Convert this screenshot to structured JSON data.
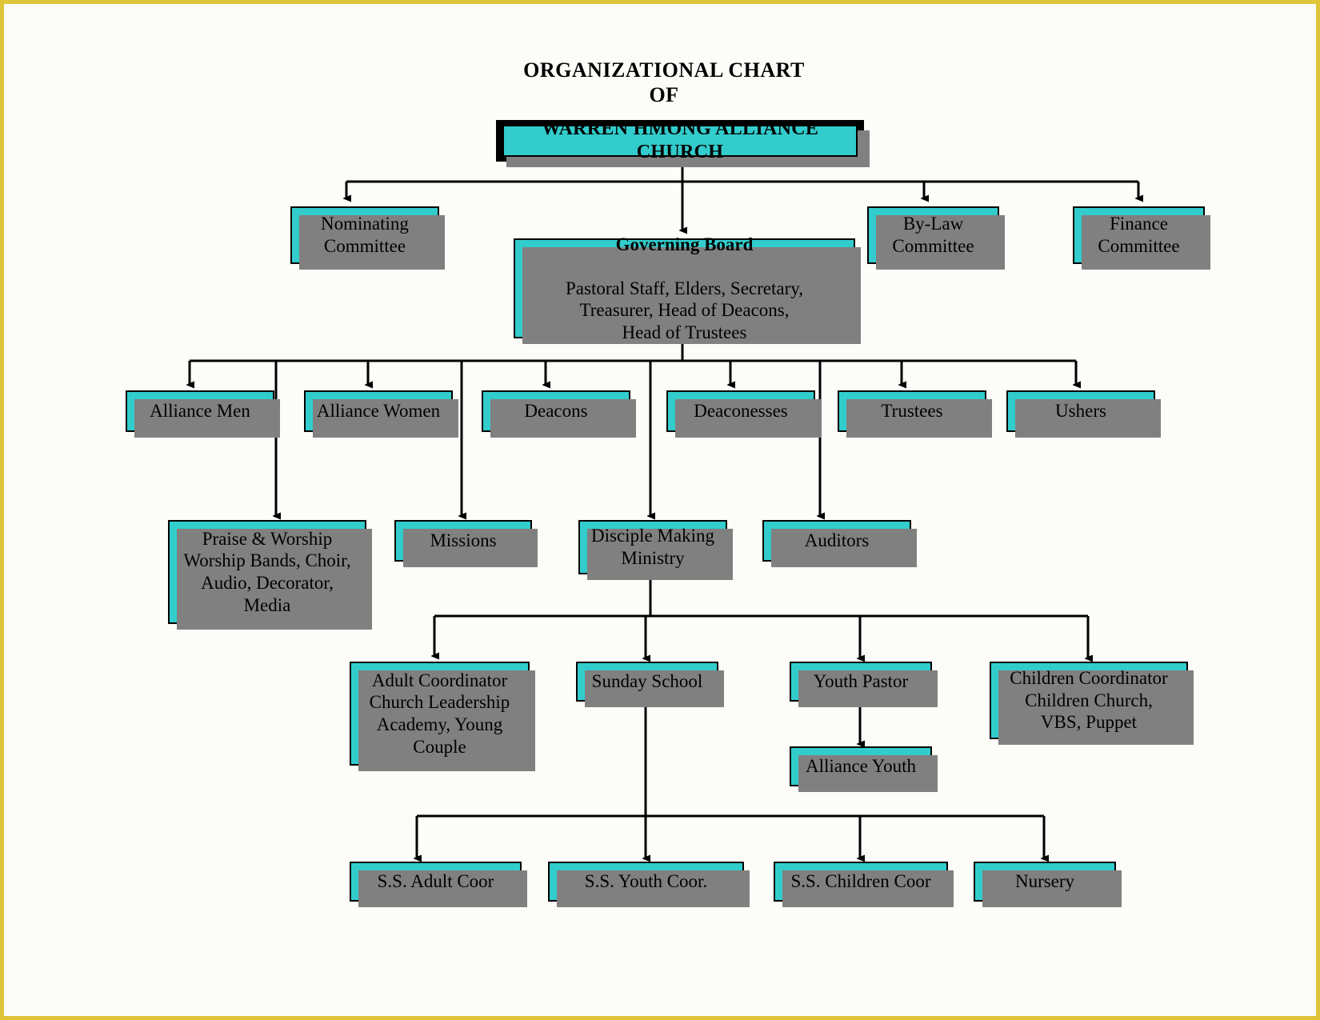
{
  "page": {
    "background_color": "#fcfdf8",
    "border_color": "#dfc43a",
    "node_fill_color": "#33cccc",
    "node_border_color": "#000000",
    "node_shadow_color": "#808080",
    "connector_color": "#000000"
  },
  "title": {
    "line1": "ORGANIZATIONAL CHART",
    "line2": "OF"
  },
  "chart_data": {
    "type": "diagram",
    "subtype": "organizational-chart",
    "title": "ORGANIZATIONAL CHART OF WARREN HMONG ALLIANCE CHURCH",
    "nodes": {
      "root": {
        "label": "WARREN HMONG ALLIANCE CHURCH"
      },
      "nominating_committee": {
        "label": "Nominating\nCommittee"
      },
      "governing_board": {
        "heading": "Governing Board",
        "body": "Pastoral Staff, Elders, Secretary,\nTreasurer, Head of Deacons,\nHead of Trustees"
      },
      "bylaw_committee": {
        "label": "By-Law\nCommittee"
      },
      "finance_committee": {
        "label": "Finance\nCommittee"
      },
      "alliance_men": {
        "label": "Alliance Men"
      },
      "alliance_women": {
        "label": "Alliance Women"
      },
      "deacons": {
        "label": "Deacons"
      },
      "deaconesses": {
        "label": "Deaconesses"
      },
      "trustees": {
        "label": "Trustees"
      },
      "ushers": {
        "label": "Ushers"
      },
      "praise_worship": {
        "label": "Praise & Worship\nWorship Bands, Choir,\nAudio, Decorator,\nMedia"
      },
      "missions": {
        "label": "Missions"
      },
      "disciple_making_ministry": {
        "label": "Disciple Making\nMinistry"
      },
      "auditors": {
        "label": "Auditors"
      },
      "adult_coordinator": {
        "label": "Adult Coordinator\nChurch Leadership\nAcademy, Young\nCouple"
      },
      "sunday_school": {
        "label": "Sunday School"
      },
      "youth_pastor": {
        "label": "Youth Pastor"
      },
      "children_coordinator": {
        "label": "Children Coordinator\nChildren Church,\nVBS, Puppet"
      },
      "alliance_youth": {
        "label": "Alliance Youth"
      },
      "ss_adult_coor": {
        "label": "S.S. Adult Coor"
      },
      "ss_youth_coor": {
        "label": "S.S. Youth Coor."
      },
      "ss_children_coor": {
        "label": "S.S. Children Coor"
      },
      "nursery": {
        "label": "Nursery"
      }
    },
    "edges": [
      {
        "from": "root",
        "to": "nominating_committee"
      },
      {
        "from": "root",
        "to": "governing_board"
      },
      {
        "from": "root",
        "to": "bylaw_committee"
      },
      {
        "from": "root",
        "to": "finance_committee"
      },
      {
        "from": "governing_board",
        "to": "alliance_men"
      },
      {
        "from": "governing_board",
        "to": "alliance_women"
      },
      {
        "from": "governing_board",
        "to": "deacons"
      },
      {
        "from": "governing_board",
        "to": "deaconesses"
      },
      {
        "from": "governing_board",
        "to": "trustees"
      },
      {
        "from": "governing_board",
        "to": "ushers"
      },
      {
        "from": "alliance_men",
        "to": "praise_worship"
      },
      {
        "from": "alliance_women",
        "to": "missions"
      },
      {
        "from": "governing_board",
        "to": "disciple_making_ministry"
      },
      {
        "from": "deaconesses",
        "to": "auditors"
      },
      {
        "from": "disciple_making_ministry",
        "to": "adult_coordinator"
      },
      {
        "from": "disciple_making_ministry",
        "to": "sunday_school"
      },
      {
        "from": "disciple_making_ministry",
        "to": "youth_pastor"
      },
      {
        "from": "disciple_making_ministry",
        "to": "children_coordinator"
      },
      {
        "from": "youth_pastor",
        "to": "alliance_youth"
      },
      {
        "from": "sunday_school",
        "to": "ss_adult_coor"
      },
      {
        "from": "sunday_school",
        "to": "ss_youth_coor"
      },
      {
        "from": "sunday_school",
        "to": "ss_children_coor"
      },
      {
        "from": "sunday_school",
        "to": "nursery"
      }
    ]
  }
}
